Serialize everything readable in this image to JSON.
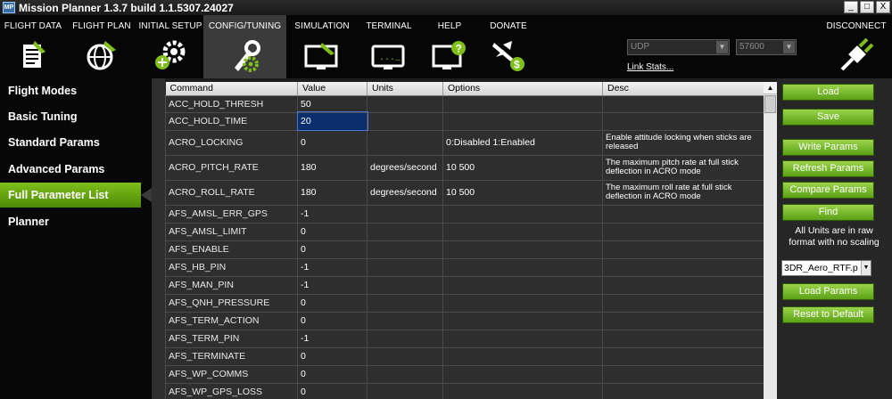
{
  "window": {
    "title": "Mission Planner 1.3.7 build 1.1.5307.24027",
    "minimize": "_",
    "maximize": "□",
    "close": "X"
  },
  "menu": {
    "items": [
      {
        "label": "FLIGHT DATA",
        "icon": "flight-data-icon"
      },
      {
        "label": "FLIGHT PLAN",
        "icon": "flight-plan-globe-icon"
      },
      {
        "label": "INITIAL SETUP",
        "icon": "initial-setup-gear-icon"
      },
      {
        "label": "CONFIG/TUNING",
        "icon": "config-tuning-wrench-icon"
      },
      {
        "label": "SIMULATION",
        "icon": "simulation-monitor-icon"
      },
      {
        "label": "TERMINAL",
        "icon": "terminal-monitor-icon"
      },
      {
        "label": "HELP",
        "icon": "help-monitor-icon"
      },
      {
        "label": "DONATE",
        "icon": "donate-plane-icon"
      }
    ],
    "connection_type": "UDP",
    "baud_rate": "57600",
    "link_stats": "Link Stats...",
    "disconnect": "DISCONNECT"
  },
  "sidebar": {
    "items": [
      {
        "label": "Flight Modes"
      },
      {
        "label": "Basic Tuning"
      },
      {
        "label": "Standard Params"
      },
      {
        "label": "Advanced Params"
      },
      {
        "label": "Full Parameter List"
      },
      {
        "label": "Planner"
      }
    ],
    "active_index": 4
  },
  "grid": {
    "headers": [
      "Command",
      "Value",
      "Units",
      "Options",
      "Desc"
    ],
    "rows": [
      {
        "command": "ACC_HOLD_THRESH",
        "value": "50",
        "units": "",
        "options": "",
        "desc": ""
      },
      {
        "command": "ACC_HOLD_TIME",
        "value": "20",
        "units": "",
        "options": "",
        "desc": ""
      },
      {
        "command": "ACRO_LOCKING",
        "value": "0",
        "units": "",
        "options": "0:Disabled 1:Enabled",
        "desc": "Enable attitude locking when sticks are released"
      },
      {
        "command": "ACRO_PITCH_RATE",
        "value": "180",
        "units": "degrees/second",
        "options": "10 500",
        "desc": "The maximum pitch rate at full stick deflection in ACRO mode"
      },
      {
        "command": "ACRO_ROLL_RATE",
        "value": "180",
        "units": "degrees/second",
        "options": "10 500",
        "desc": "The maximum roll rate at full stick deflection in ACRO mode"
      },
      {
        "command": "AFS_AMSL_ERR_GPS",
        "value": "-1",
        "units": "",
        "options": "",
        "desc": ""
      },
      {
        "command": "AFS_AMSL_LIMIT",
        "value": "0",
        "units": "",
        "options": "",
        "desc": ""
      },
      {
        "command": "AFS_ENABLE",
        "value": "0",
        "units": "",
        "options": "",
        "desc": ""
      },
      {
        "command": "AFS_HB_PIN",
        "value": "-1",
        "units": "",
        "options": "",
        "desc": ""
      },
      {
        "command": "AFS_MAN_PIN",
        "value": "-1",
        "units": "",
        "options": "",
        "desc": ""
      },
      {
        "command": "AFS_QNH_PRESSURE",
        "value": "0",
        "units": "",
        "options": "",
        "desc": ""
      },
      {
        "command": "AFS_TERM_ACTION",
        "value": "0",
        "units": "",
        "options": "",
        "desc": ""
      },
      {
        "command": "AFS_TERM_PIN",
        "value": "-1",
        "units": "",
        "options": "",
        "desc": ""
      },
      {
        "command": "AFS_TERMINATE",
        "value": "0",
        "units": "",
        "options": "",
        "desc": ""
      },
      {
        "command": "AFS_WP_COMMS",
        "value": "0",
        "units": "",
        "options": "",
        "desc": ""
      },
      {
        "command": "AFS_WP_GPS_LOSS",
        "value": "0",
        "units": "",
        "options": "",
        "desc": ""
      }
    ],
    "selected_row": 1
  },
  "right_panel": {
    "load": "Load",
    "save": "Save",
    "write_params": "Write Params",
    "refresh_params": "Refresh Params",
    "compare_params": "Compare Params",
    "find": "Find",
    "units_note": "All Units are in raw format with no scaling",
    "param_file": "3DR_Aero_RTF.p",
    "load_params": "Load Params",
    "reset_default": "Reset to Default"
  },
  "colors": {
    "accent_green": "#6fb41a",
    "selection_blue": "#0a2e6e",
    "background": "#1e1e1e"
  }
}
